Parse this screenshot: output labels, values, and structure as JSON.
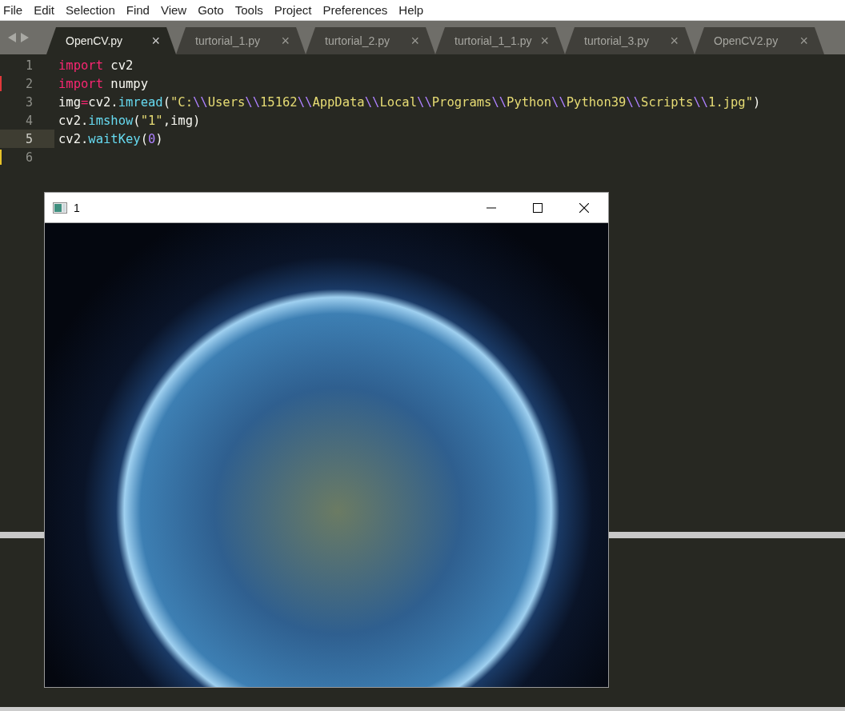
{
  "menu": [
    "File",
    "Edit",
    "Selection",
    "Find",
    "View",
    "Goto",
    "Tools",
    "Project",
    "Preferences",
    "Help"
  ],
  "tabs": [
    {
      "label": "OpenCV.py",
      "close": "×",
      "selected": true
    },
    {
      "label": "turtorial_1.py",
      "close": "×",
      "selected": false
    },
    {
      "label": "turtorial_2.py",
      "close": "×",
      "selected": false
    },
    {
      "label": "turtorial_1_1.py",
      "close": "×",
      "selected": false
    },
    {
      "label": "turtorial_3.py",
      "close": "×",
      "selected": false
    },
    {
      "label": "OpenCV2.py",
      "close": "×",
      "selected": false
    }
  ],
  "editor": {
    "lines": [
      {
        "number": "1",
        "current": false,
        "tokens": [
          {
            "kind": "keyword",
            "text": "import"
          },
          {
            "kind": "plain",
            "text": " cv2"
          }
        ]
      },
      {
        "number": "2",
        "current": false,
        "color": "#e0383b",
        "tokens": [
          {
            "kind": "keyword",
            "text": "import"
          },
          {
            "kind": "plain",
            "text": " numpy"
          }
        ]
      },
      {
        "number": "3",
        "current": false,
        "tokens": [
          {
            "kind": "plain",
            "text": "img"
          },
          {
            "kind": "keyword",
            "text": "="
          },
          {
            "kind": "plain",
            "text": "cv2."
          },
          {
            "kind": "function",
            "text": "imread"
          },
          {
            "kind": "plain",
            "text": "("
          },
          {
            "kind": "string",
            "text": "\"C:"
          },
          {
            "kind": "escape",
            "text": "\\\\"
          },
          {
            "kind": "string",
            "text": "Users"
          },
          {
            "kind": "escape",
            "text": "\\\\"
          },
          {
            "kind": "string",
            "text": "15162"
          },
          {
            "kind": "escape",
            "text": "\\\\"
          },
          {
            "kind": "string",
            "text": "AppData"
          },
          {
            "kind": "escape",
            "text": "\\\\"
          },
          {
            "kind": "string",
            "text": "Local"
          },
          {
            "kind": "escape",
            "text": "\\\\"
          },
          {
            "kind": "string",
            "text": "Programs"
          },
          {
            "kind": "escape",
            "text": "\\\\"
          },
          {
            "kind": "string",
            "text": "Python"
          },
          {
            "kind": "escape",
            "text": "\\\\"
          },
          {
            "kind": "string",
            "text": "Python39"
          },
          {
            "kind": "escape",
            "text": "\\\\"
          },
          {
            "kind": "string",
            "text": "Scripts"
          },
          {
            "kind": "escape",
            "text": "\\\\"
          },
          {
            "kind": "string",
            "text": "1.jpg\""
          },
          {
            "kind": "plain",
            "text": ")"
          }
        ]
      },
      {
        "number": "4",
        "current": false,
        "tokens": [
          {
            "kind": "plain",
            "text": "cv2."
          },
          {
            "kind": "function",
            "text": "imshow"
          },
          {
            "kind": "plain",
            "text": "("
          },
          {
            "kind": "string",
            "text": "\"1\""
          },
          {
            "kind": "plain",
            "text": ",img)"
          }
        ]
      },
      {
        "number": "5",
        "current": true,
        "tokens": [
          {
            "kind": "plain",
            "text": "cv2."
          },
          {
            "kind": "function",
            "text": "waitKey"
          },
          {
            "kind": "plain",
            "text": "("
          },
          {
            "kind": "number",
            "text": "0"
          },
          {
            "kind": "plain",
            "text": ")"
          }
        ]
      },
      {
        "number": "6",
        "current": false,
        "color": "#e6c229"
      }
    ]
  },
  "image_window": {
    "title": "1"
  }
}
